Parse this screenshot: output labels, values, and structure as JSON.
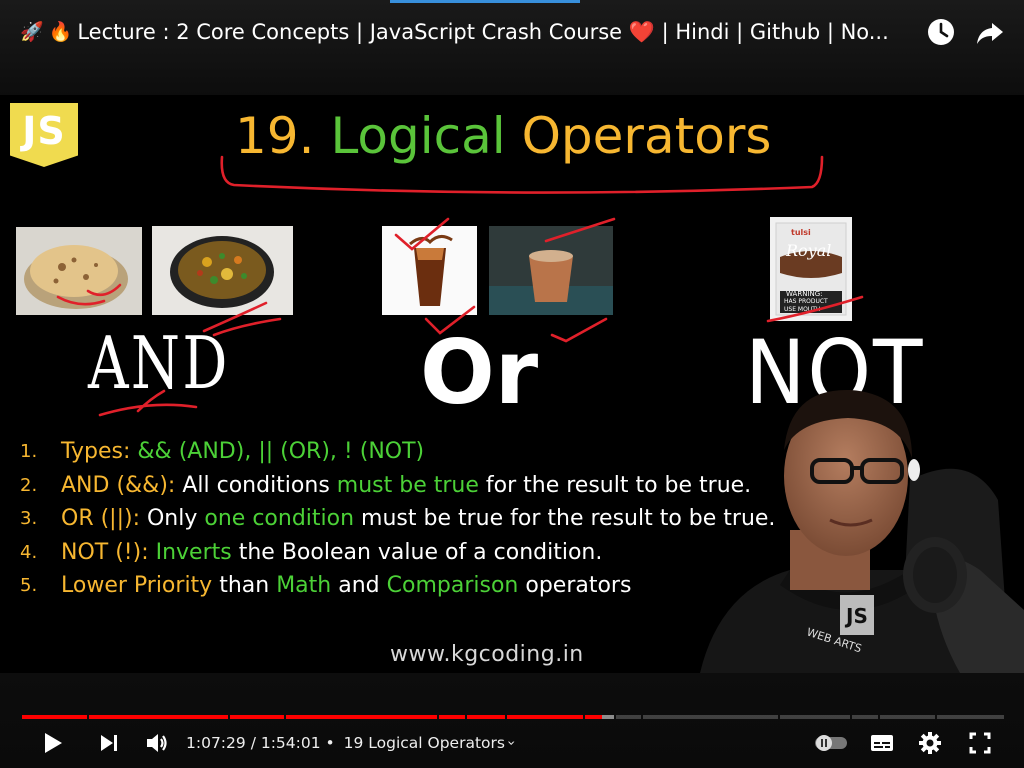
{
  "video_title": "Lecture : 2 Core Concepts | JavaScript Crash Course ❤️ | Hindi | Github | No...",
  "title_emojis": [
    "🚀",
    "🔥"
  ],
  "top_actions": [
    "watch-later-icon",
    "share-icon"
  ],
  "slide": {
    "logo_text": "JS",
    "title_number": "19.",
    "title_word1": "Logical",
    "title_word2": "Operators",
    "label_and": "AND",
    "label_or": "Or",
    "label_not": "NOT",
    "packet_brand": "tulsi",
    "packet_name": "Royal",
    "packet_warning": "WARNING:",
    "packet_line1": "HAS PRODUCT",
    "packet_line2": "USE MOUTH",
    "points": [
      {
        "num": "1.",
        "parts": [
          {
            "t": "Types: && (AND), || (OR), ! (NOT)",
            "c": "mix1"
          }
        ]
      },
      {
        "num": "2.",
        "a": "AND (&&):",
        "b": " All conditions ",
        "c": "must be true",
        "d": " for the result to be true."
      },
      {
        "num": "3.",
        "a": "OR (||):",
        "b": " Only ",
        "c": "one condition",
        "d": " must be true for the result to be true."
      },
      {
        "num": "4.",
        "a": "NOT (!):",
        "b": " ",
        "c": "Inverts",
        "d": " the Boolean value of a condition."
      },
      {
        "num": "5.",
        "a": "Lower Priority",
        "b": " than ",
        "c": "Math",
        "d": " and ",
        "e": "Comparison",
        "f": " operators"
      }
    ],
    "p1_label": "Types:",
    "p1_and": "&& (AND),",
    "p1_or": "|| (OR),",
    "p1_not": "! (NOT)",
    "website": "www.kgcoding.in"
  },
  "player": {
    "current_time": "1:07:29",
    "separator": " / ",
    "duration": "1:54:01",
    "chapter_prefix": " • ",
    "chapter": "19 Logical Operators",
    "chapter_chevron": "›",
    "progress_fraction": 0.591,
    "buffered_fraction": 0.604,
    "icons": [
      "play-icon",
      "next-icon",
      "volume-icon",
      "autoplay-toggle",
      "subtitles-icon",
      "settings-icon",
      "fullscreen-icon"
    ],
    "accent_color": "#ff0000"
  },
  "colors": {
    "title_orange": "#f7b731",
    "title_green": "#5ac43a",
    "text_green": "#4cd137",
    "js_yellow": "#f0db4f",
    "annotation_red": "#e0202a"
  }
}
